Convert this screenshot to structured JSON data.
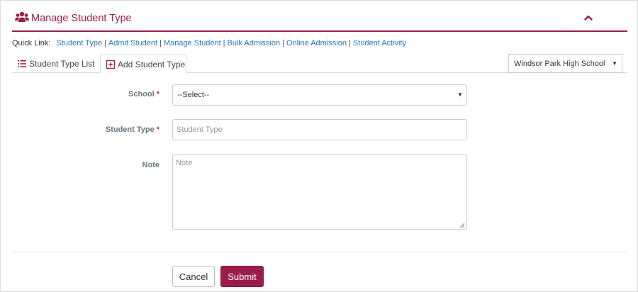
{
  "header": {
    "title": "Manage Student Type",
    "icon": "users-icon",
    "collapse_icon": "chevron-up-icon",
    "accent_color": "#9b1d4c"
  },
  "quick_links": {
    "label": "Quick Link:",
    "links": [
      "Student Type",
      "Admit Student",
      "Manage Student",
      "Bulk Admission",
      "Online Admission",
      "Student Activity"
    ],
    "separator": "|",
    "link_color": "#2a7ab8"
  },
  "tabs": {
    "list_label": "Student Type List",
    "add_label": "Add Student Type",
    "active": "Add Student Type"
  },
  "school_filter": {
    "selected": "Windsor Park High School"
  },
  "form": {
    "school": {
      "label": "School",
      "required_mark": "*",
      "selected": "--Select--"
    },
    "student_type": {
      "label": "Student Type",
      "required_mark": "*",
      "placeholder": "Student Type",
      "value": ""
    },
    "note": {
      "label": "Note",
      "placeholder": "Note",
      "value": ""
    }
  },
  "buttons": {
    "cancel": "Cancel",
    "submit": "Submit"
  }
}
